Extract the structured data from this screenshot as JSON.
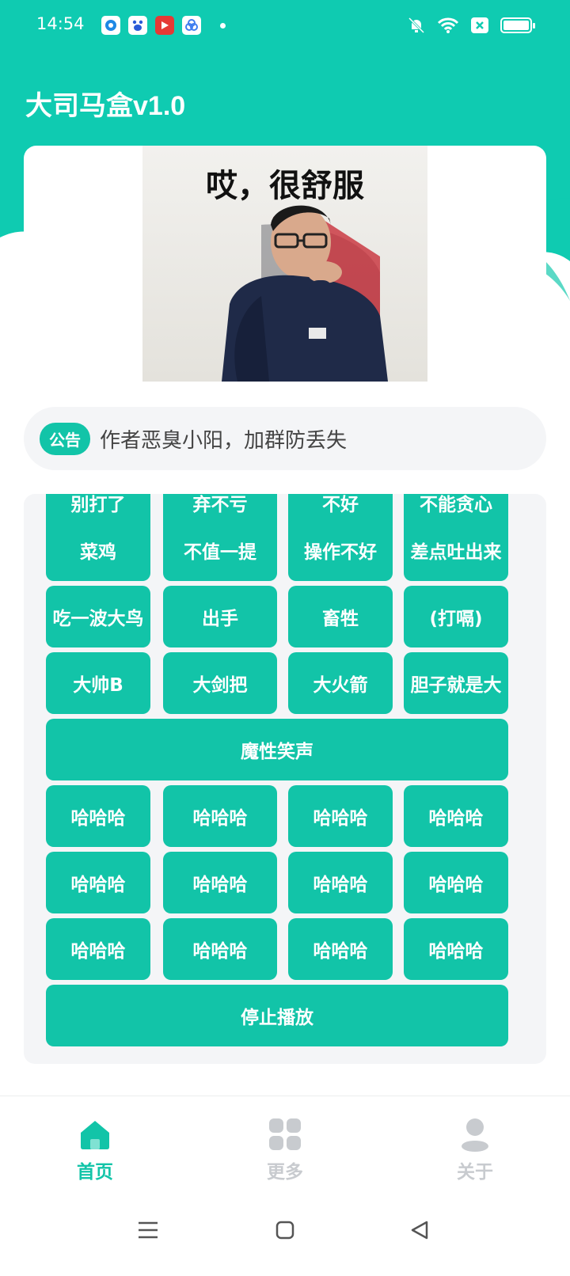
{
  "status_bar": {
    "time": "14:54",
    "apps": [
      {
        "icon": "blue-circle-app-icon",
        "color": "#1e88e5"
      },
      {
        "icon": "baidu-paw-app-icon",
        "color": "#2a5bd7"
      },
      {
        "icon": "red-video-app-icon",
        "color": "#e53935"
      },
      {
        "icon": "cluster-app-icon",
        "color": "#3f7ef0"
      }
    ]
  },
  "header": {
    "title": "大司马盒v1.0"
  },
  "banner": {
    "caption": "哎，很舒服"
  },
  "notice": {
    "tag": "公告",
    "text": "作者恶臭小阳，加群防丢失"
  },
  "sound_buttons": {
    "row0": [
      "别打了",
      "弃不亏",
      "不好",
      "不能贪心"
    ],
    "row1": [
      "菜鸡",
      "不值一提",
      "操作不好",
      "差点吐出来"
    ],
    "row2": [
      "吃一波大鸟",
      "出手",
      "畜牲",
      "(打嗝)"
    ],
    "row3": [
      "大帅B",
      "大剑把",
      "大火箭",
      "胆子就是大"
    ],
    "section_laugh": "魔性笑声",
    "row4": [
      "哈哈哈",
      "哈哈哈",
      "哈哈哈",
      "哈哈哈"
    ],
    "row5": [
      "哈哈哈",
      "哈哈哈",
      "哈哈哈",
      "哈哈哈"
    ],
    "row6": [
      "哈哈哈",
      "哈哈哈",
      "哈哈哈",
      "哈哈哈"
    ],
    "stop": "停止播放"
  },
  "bottom_nav": {
    "home": "首页",
    "more": "更多",
    "about": "关于"
  },
  "colors": {
    "accent": "#12c4a8",
    "nav_active": "#12c4a8",
    "nav_inactive": "#c8cbcf"
  }
}
